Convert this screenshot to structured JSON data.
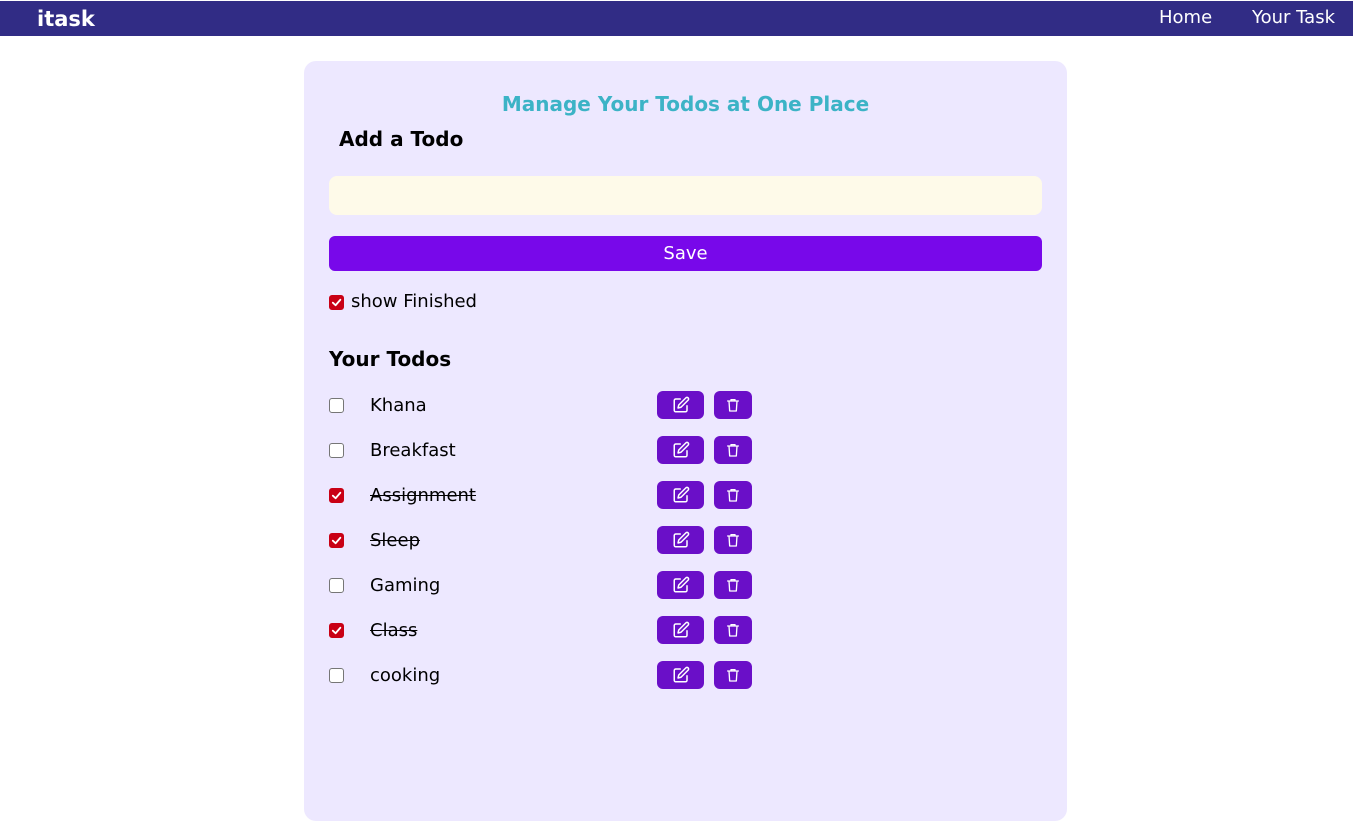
{
  "navbar": {
    "brand": "itask",
    "links": [
      "Home",
      "Your Task"
    ]
  },
  "main": {
    "headline": "Manage Your Todos at One Place",
    "add_title": "Add a Todo",
    "input_value": "",
    "save_label": "Save",
    "show_finished_label": "show Finished",
    "show_finished_checked": true,
    "todos_title": "Your Todos",
    "todos": [
      {
        "text": "Khana",
        "done": false
      },
      {
        "text": "Breakfast",
        "done": false
      },
      {
        "text": "Assignment",
        "done": true
      },
      {
        "text": "Sleep",
        "done": true
      },
      {
        "text": "Gaming",
        "done": false
      },
      {
        "text": "Class",
        "done": true
      },
      {
        "text": "cooking",
        "done": false
      }
    ]
  },
  "icons": {
    "edit": "edit-icon",
    "delete": "trash-icon",
    "check": "check-icon"
  },
  "colors": {
    "navbar": "#312c85",
    "card": "#ede8ff",
    "headline": "#3cb3c6",
    "save_button": "#7808ea",
    "action_button": "#6a0fc8",
    "checkbox_checked": "#c90015",
    "input_bg": "#fefae9"
  }
}
